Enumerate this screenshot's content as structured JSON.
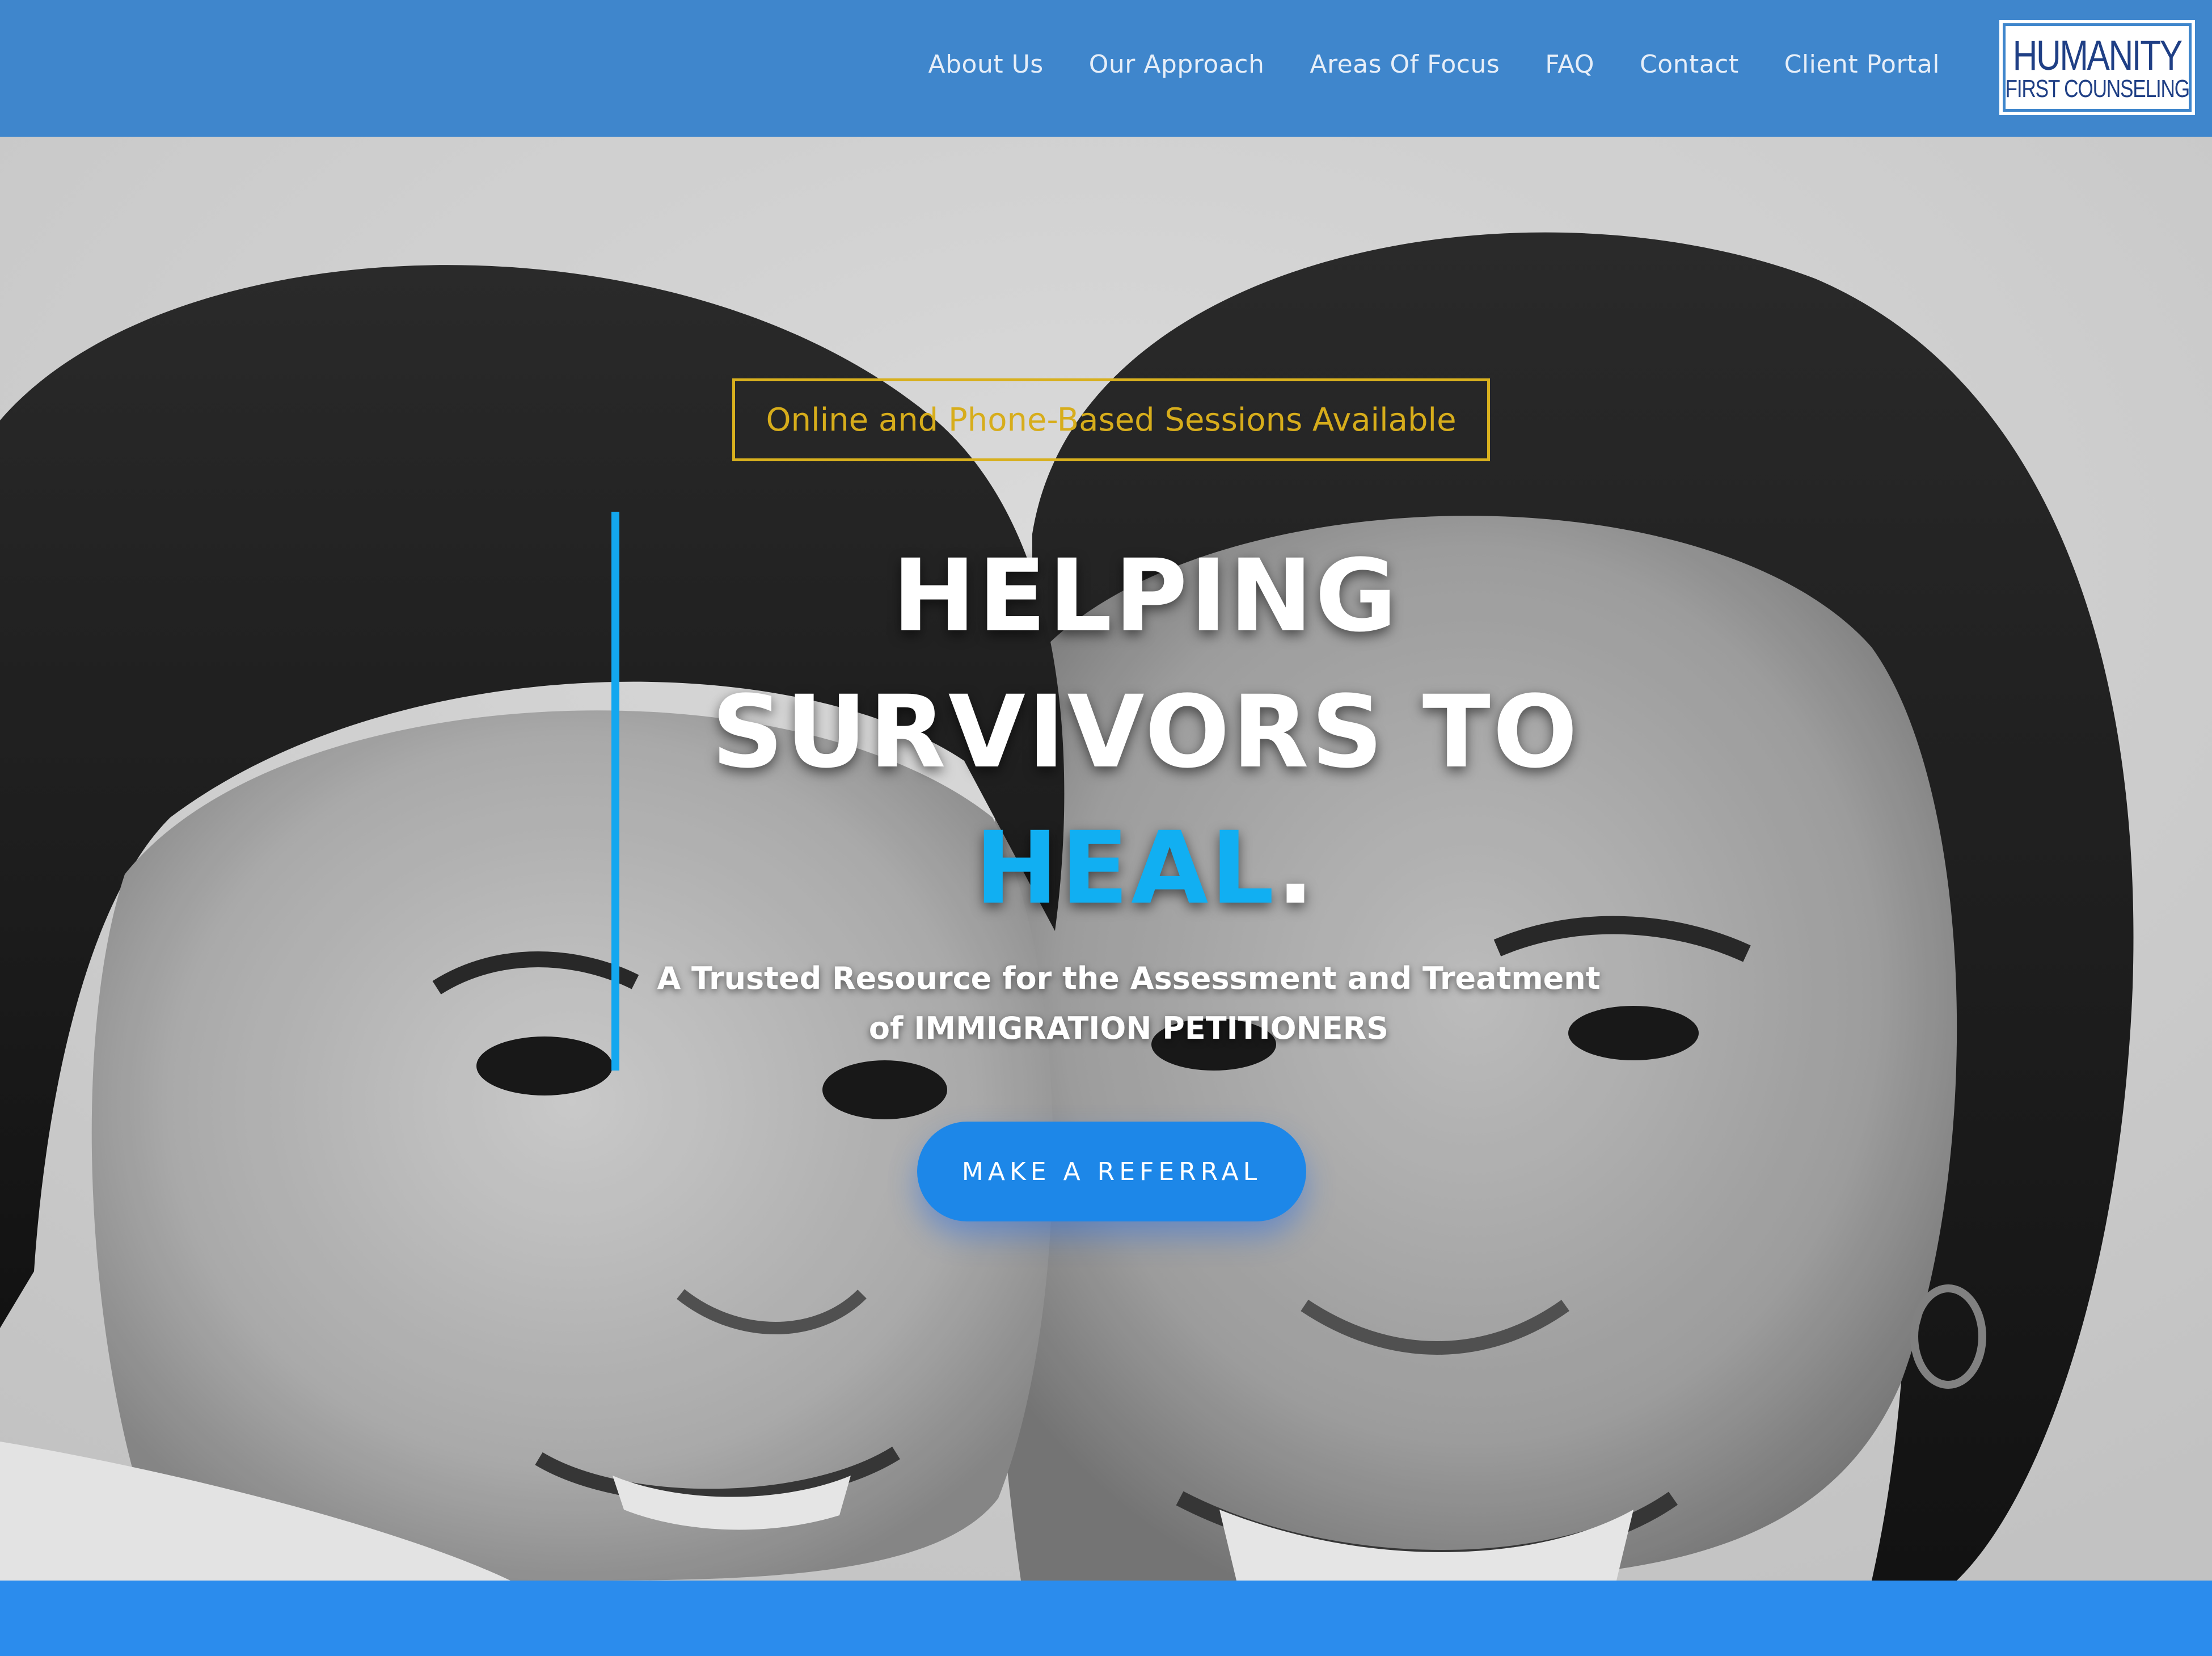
{
  "header": {
    "nav": [
      {
        "label": "About Us"
      },
      {
        "label": "Our Approach"
      },
      {
        "label": "Areas Of Focus"
      },
      {
        "label": "FAQ"
      },
      {
        "label": "Contact"
      },
      {
        "label": "Client Portal"
      }
    ],
    "logo": {
      "line1": "HUMANITY",
      "line2": "FIRST COUNSELING"
    }
  },
  "hero": {
    "badge": "Online and Phone-Based Sessions Available",
    "headline": {
      "line1": "HELPING",
      "line2": "SURVIVORS TO",
      "highlight": "HEAL",
      "punct": "."
    },
    "subtext": {
      "line1": "A Trusted Resource for the Assessment and Treatment",
      "line2": "of IMMIGRATION PETITIONERS"
    },
    "cta_label": "MAKE A REFERRAL",
    "photo_icon": "photo-of-two-smiling-faces-grayscale"
  },
  "colors": {
    "header_bg": "#3f86cc",
    "accent_blue": "#11aff2",
    "badge_gold": "#d7ad1b",
    "cta_blue": "#1d87e8",
    "band_blue": "#2b8ced"
  }
}
